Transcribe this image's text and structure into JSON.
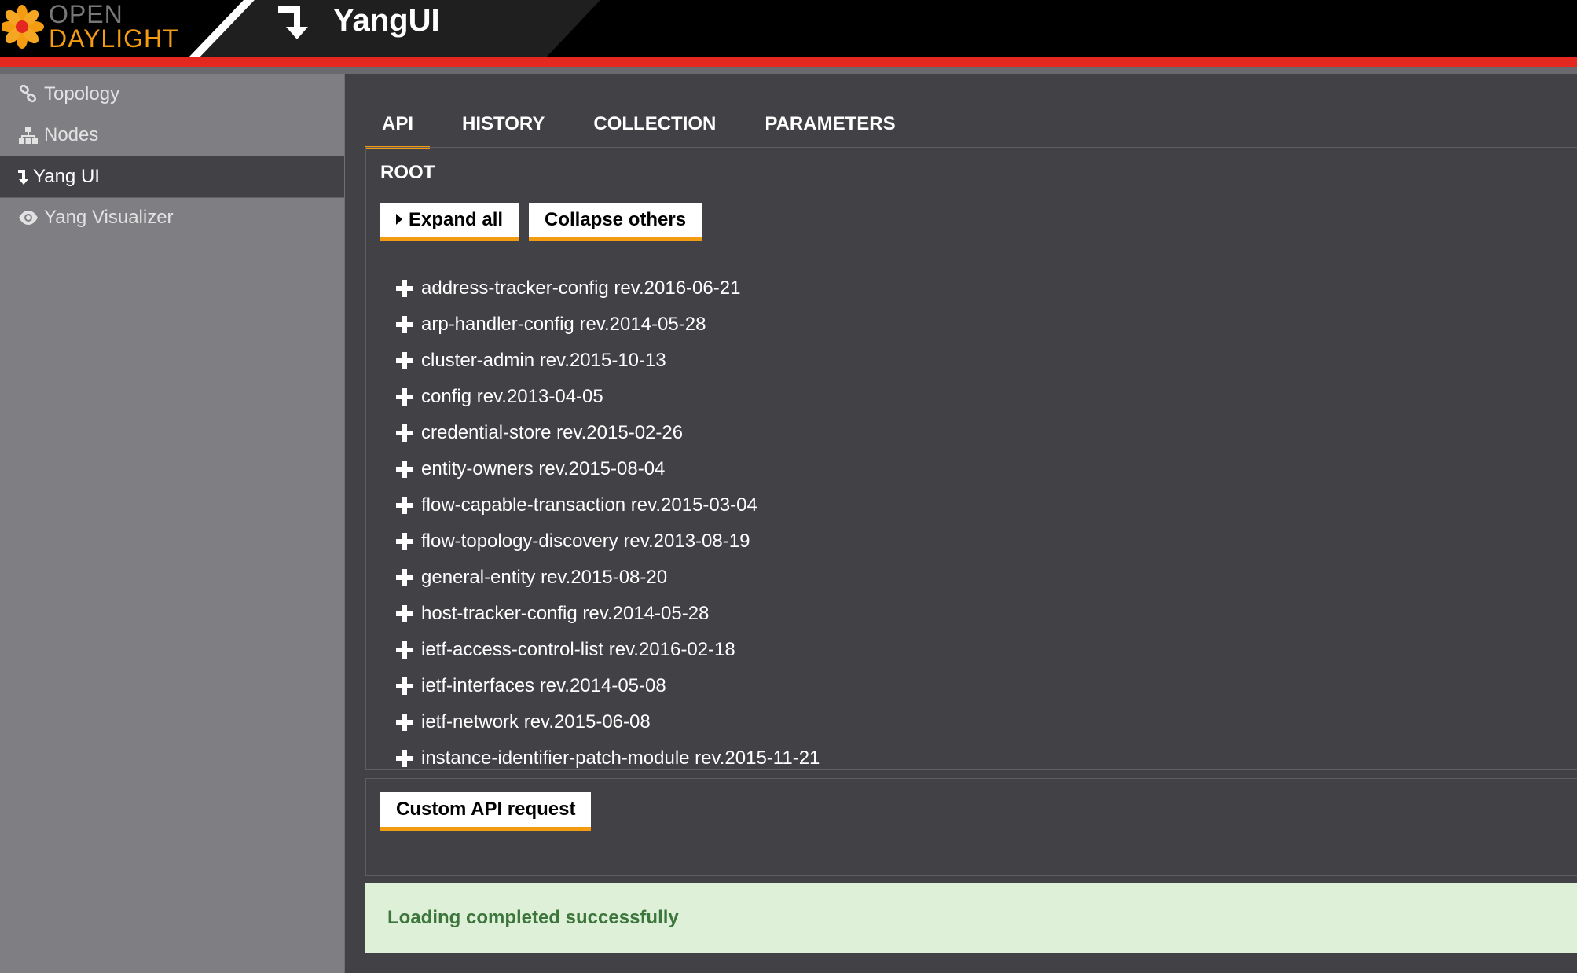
{
  "header": {
    "logo_top": "OPEN",
    "logo_bottom": "DAYLIGHT",
    "title": "YangUI",
    "colors": {
      "accent_red": "#e4281f",
      "accent_orange": "#f39c12",
      "background": "#000000"
    }
  },
  "sidebar": {
    "items": [
      {
        "label": "Topology",
        "icon": "link-icon",
        "active": false
      },
      {
        "label": "Nodes",
        "icon": "sitemap-icon",
        "active": false
      },
      {
        "label": "Yang UI",
        "icon": "arrow-down-icon",
        "active": true
      },
      {
        "label": "Yang Visualizer",
        "icon": "eye-icon",
        "active": false
      }
    ]
  },
  "tabs": [
    {
      "label": "API",
      "active": true
    },
    {
      "label": "HISTORY",
      "active": false
    },
    {
      "label": "COLLECTION",
      "active": false
    },
    {
      "label": "PARAMETERS",
      "active": false
    }
  ],
  "api": {
    "root_label": "ROOT",
    "expand_all_label": "Expand all",
    "collapse_others_label": "Collapse others",
    "modules": [
      "address-tracker-config rev.2016-06-21",
      "arp-handler-config rev.2014-05-28",
      "cluster-admin rev.2015-10-13",
      "config rev.2013-04-05",
      "credential-store rev.2015-02-26",
      "entity-owners rev.2015-08-04",
      "flow-capable-transaction rev.2015-03-04",
      "flow-topology-discovery rev.2013-08-19",
      "general-entity rev.2015-08-20",
      "host-tracker-config rev.2014-05-28",
      "ietf-access-control-list rev.2016-02-18",
      "ietf-interfaces rev.2014-05-08",
      "ietf-network rev.2015-06-08",
      "instance-identifier-patch-module rev.2015-11-21"
    ]
  },
  "custom_api": {
    "button_label": "Custom API request"
  },
  "status": {
    "message": "Loading completed successfully",
    "color": "#3c763d",
    "background": "#dff0d8"
  }
}
